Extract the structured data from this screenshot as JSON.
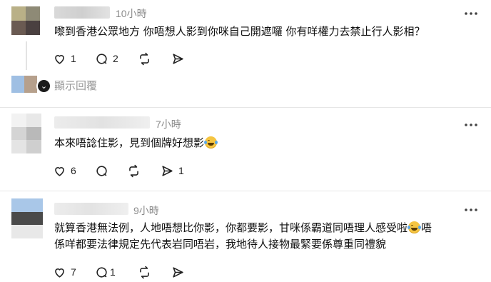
{
  "comments": [
    {
      "time": "10小時",
      "text": "嚟到香港公眾地方 你唔想人影到你咪自己開遮囉 你有咩權力去禁止行人影相？",
      "likes": "1",
      "replies": "2",
      "reposts": "",
      "shares": ""
    },
    {
      "time": "7小時",
      "text": "本來唔諗住影，見到個牌好想影",
      "likes": "6",
      "replies": "",
      "reposts": "",
      "shares": "1"
    },
    {
      "time": "9小時",
      "text_line1": "就算香港無法例，人地唔想比你影，你都要影，甘咪係霸道同唔理人感受啦",
      "text_line1_after": "唔",
      "text_line2": "係咩都要法律規定先代表岩同唔岩，我地待人接物最緊要係尊重同禮貌",
      "likes": "7",
      "replies": "1",
      "reposts": "",
      "shares": ""
    }
  ],
  "show_replies_label": "顯示回覆",
  "icons": [
    "heart-icon",
    "comment-icon",
    "repost-icon",
    "share-icon",
    "more-icon",
    "chevron-down-icon",
    "emoji-icon"
  ]
}
